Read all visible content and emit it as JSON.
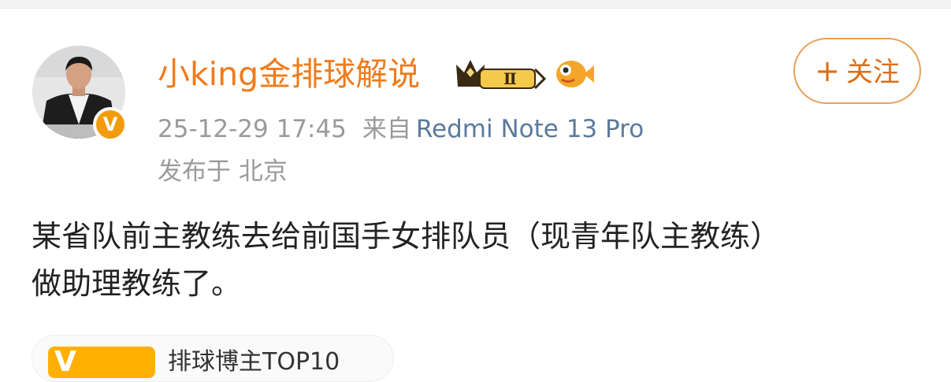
{
  "post": {
    "author": {
      "name": "小king金排球解说",
      "vip_level": "Ⅱ",
      "verified_badge": "V",
      "avatar_icon": "avatar-man-in-suit"
    },
    "follow_button": {
      "plus": "+",
      "label": "关注"
    },
    "timestamp": "25-12-29 17:45",
    "source_prefix": "来自",
    "device": "Redmi Note 13 Pro",
    "location": "发布于 北京",
    "content_lines": [
      "某省队前主教练去给前国手女排队员（现青年队主教练）",
      "做助理教练了。"
    ],
    "tag": {
      "badge": "V",
      "text": "排球博主TOP10"
    }
  },
  "colors": {
    "username": "#f07b1a",
    "follow_border": "#e8a15c",
    "device_text": "#5b7a9c",
    "meta_text": "#9a9a9a",
    "badge_orange": "#f29b0c"
  }
}
